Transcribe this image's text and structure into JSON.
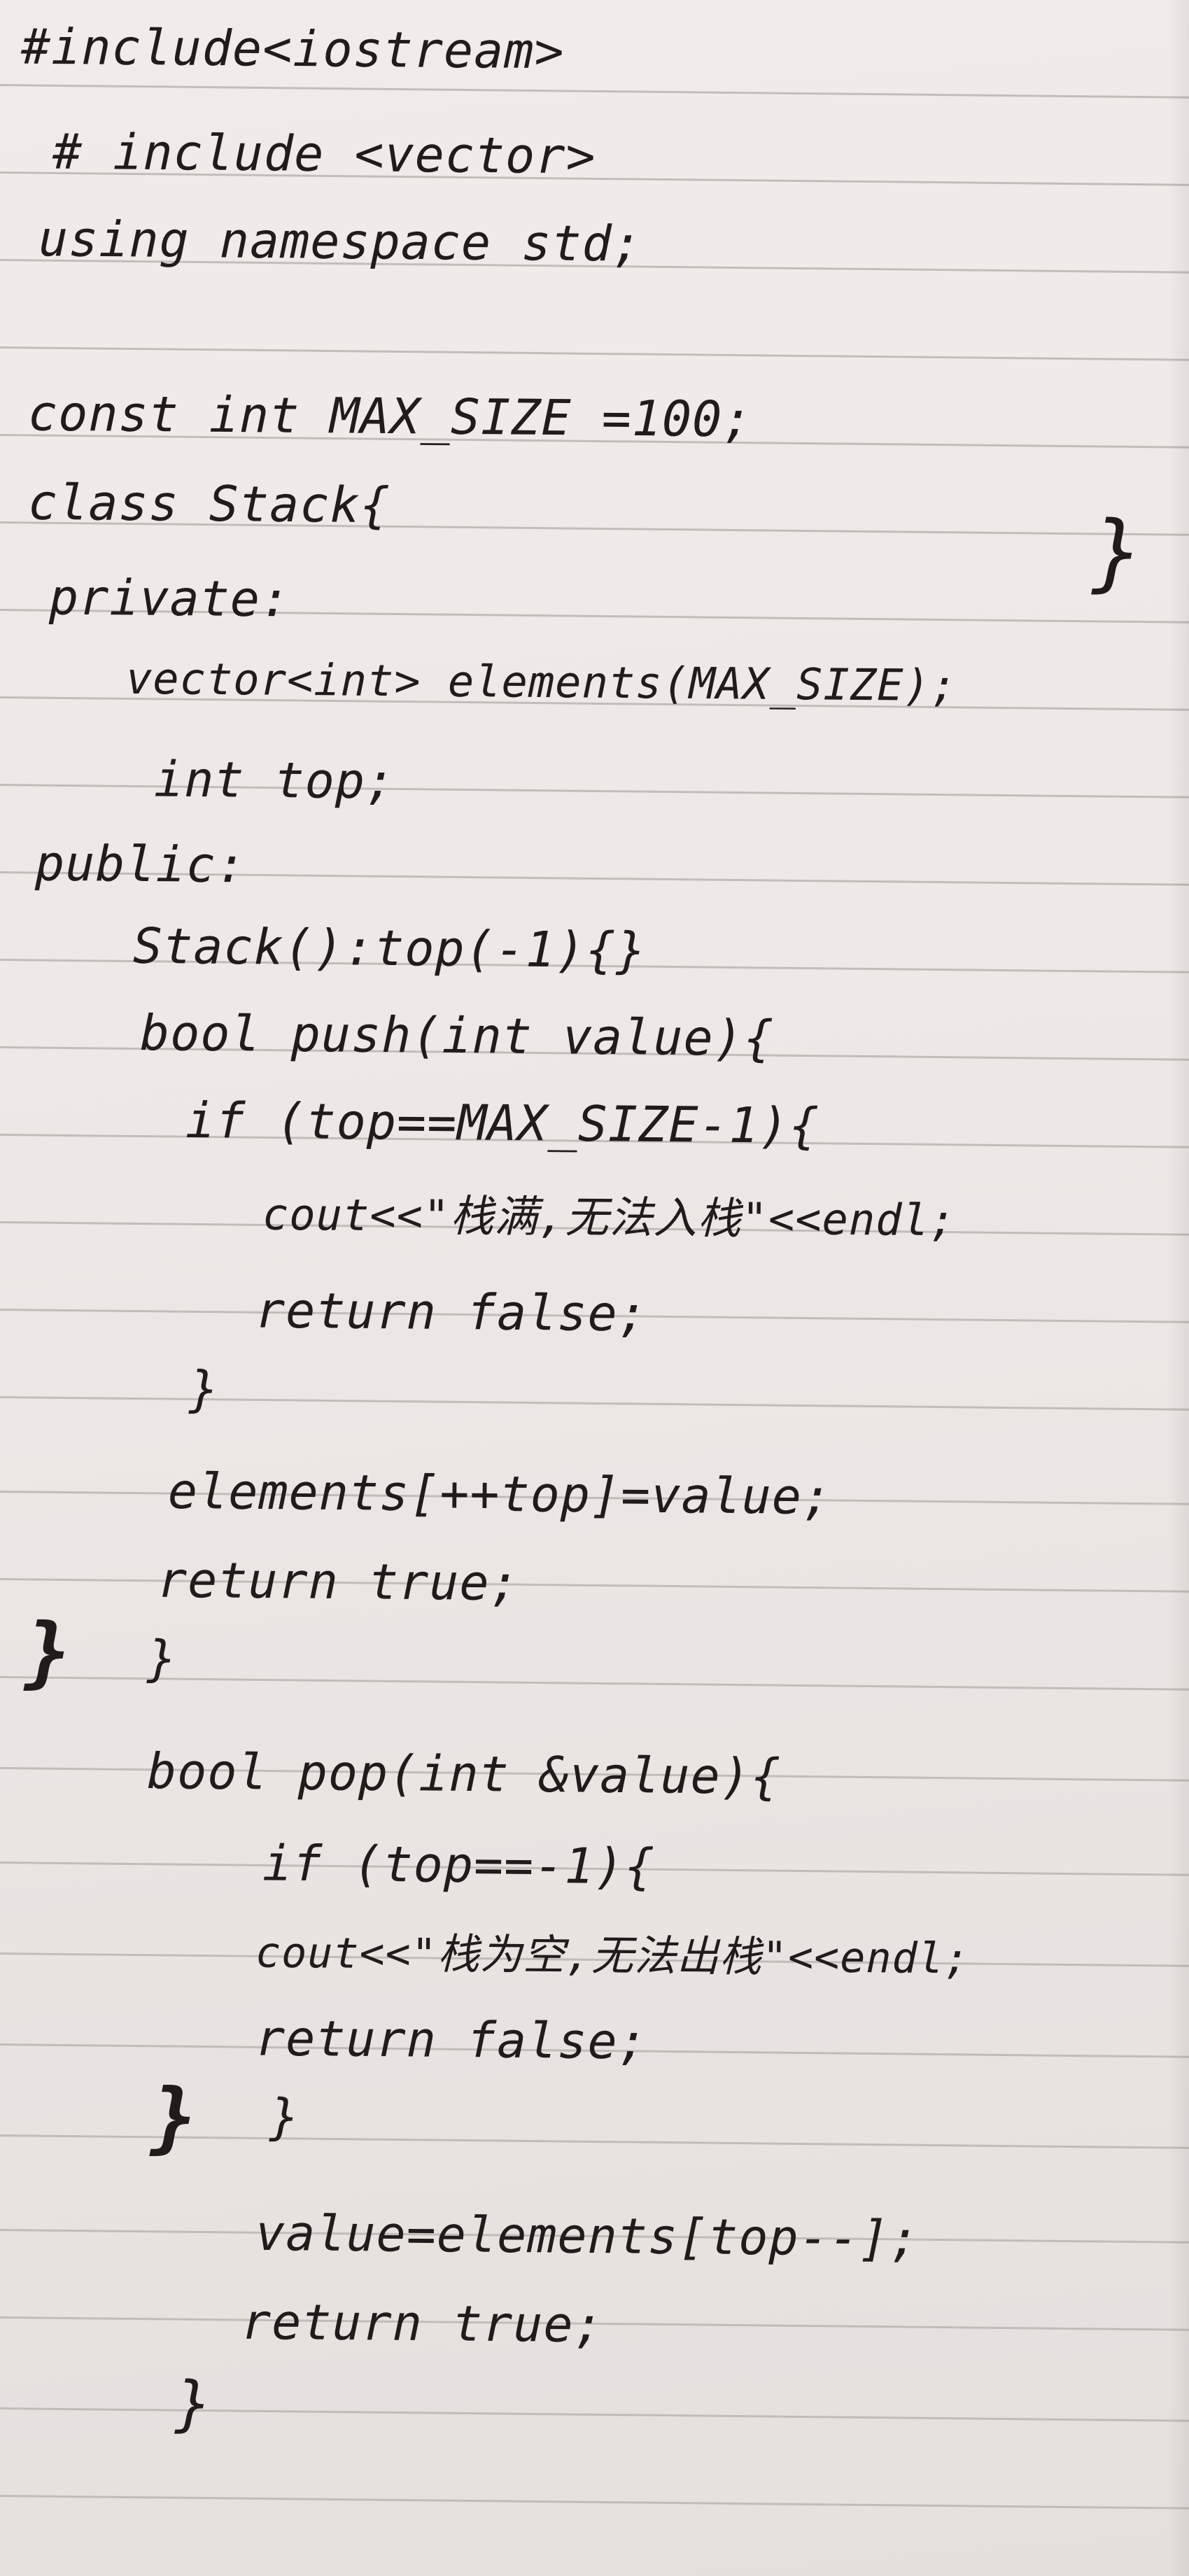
{
  "document": {
    "lines": [
      "#include<iostream>",
      "# include <vector>",
      "using namespace std;",
      "const int MAX_SIZE =100;",
      "class Stack{",
      "private:",
      "vector<int> elements(MAX_SIZE);",
      "int top;",
      "public:",
      "Stack():top(-1){}",
      "bool push(int value){",
      "if (top==MAX_SIZE-1){",
      "cout<<\"栈满,无法入栈\"<<endl;",
      "return false;",
      "}",
      "elements[++top]=value;",
      "return true;",
      "}",
      "bool pop(int &value){",
      "if (top==-1){",
      "cout<<\"栈为空,无法出栈\"<<endl;",
      "return false;",
      "}",
      "value=elements[top--];",
      "return true;",
      "}"
    ],
    "stray_marks": [
      "}",
      "}",
      "}"
    ]
  }
}
